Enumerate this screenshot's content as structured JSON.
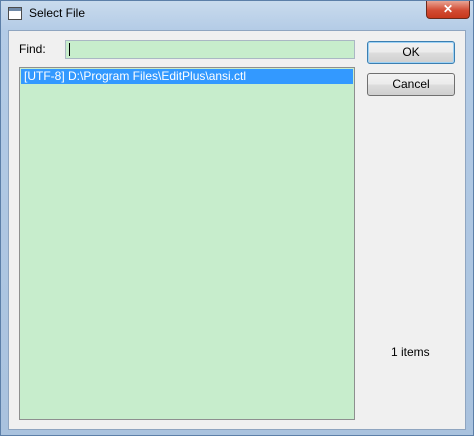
{
  "window": {
    "title": "Select File",
    "close_glyph": "✕"
  },
  "find": {
    "label": "Find:",
    "value": ""
  },
  "file_list": {
    "items": [
      "[UTF-8] D:\\Program Files\\EditPlus\\ansi.ctl"
    ],
    "selected_index": 0
  },
  "buttons": {
    "ok": "OK",
    "cancel": "Cancel"
  },
  "status": {
    "count": "1 items"
  },
  "colors": {
    "list_background": "#c7edcc",
    "selection": "#3399ff",
    "close_button": "#d24b33"
  }
}
